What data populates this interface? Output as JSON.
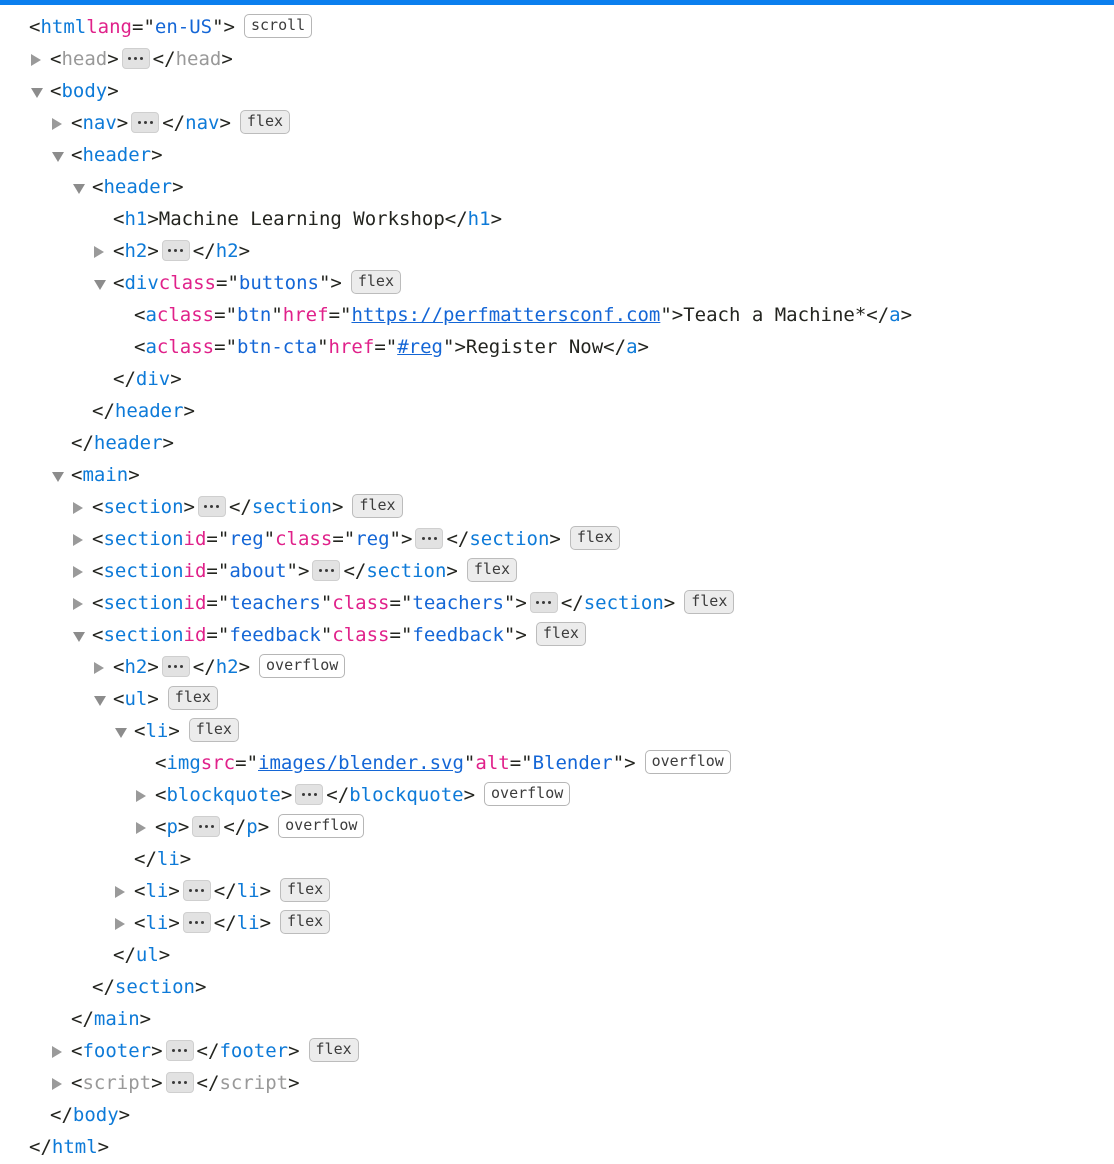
{
  "app": {
    "name": "dom-tree-inspector",
    "accent_color": "#0b7fee",
    "tag_color": "#0d7ad8",
    "attribute_color": "#e0218a",
    "value_color": "#1466d6",
    "text_color": "#23241f",
    "dim_color": "#999999"
  },
  "badges": {
    "scroll": "scroll",
    "flex": "flex",
    "overflow": "overflow"
  },
  "syntax": {
    "lt": "<",
    "gt": ">",
    "close_lt": "</",
    "eq": "=",
    "quote": "\""
  },
  "tree": {
    "lines": [
      {
        "depth": 0,
        "marker": "none",
        "tag": "html",
        "attrs": [
          {
            "name": "lang",
            "value": "en-US"
          }
        ],
        "badge": "scroll"
      },
      {
        "depth": 1,
        "marker": "closed",
        "tag": "head",
        "collapsed": true,
        "dim": true
      },
      {
        "depth": 1,
        "marker": "open",
        "tag": "body"
      },
      {
        "depth": 2,
        "marker": "closed",
        "tag": "nav",
        "collapsed": true,
        "badge": "flex"
      },
      {
        "depth": 2,
        "marker": "open",
        "tag": "header"
      },
      {
        "depth": 3,
        "marker": "open",
        "tag": "header"
      },
      {
        "depth": 4,
        "marker": "none",
        "tag": "h1",
        "inline_text": "Machine Learning Workshop"
      },
      {
        "depth": 4,
        "marker": "closed",
        "tag": "h2",
        "collapsed": true
      },
      {
        "depth": 4,
        "marker": "open",
        "tag": "div",
        "attrs": [
          {
            "name": "class",
            "value": "buttons"
          }
        ],
        "badge": "flex"
      },
      {
        "depth": 5,
        "marker": "none",
        "tag": "a",
        "attrs": [
          {
            "name": "class",
            "value": "btn"
          },
          {
            "name": "href",
            "value": "https://perfmattersconf.com",
            "link": true
          }
        ],
        "inline_text": "Teach a Machine*"
      },
      {
        "depth": 5,
        "marker": "none",
        "tag": "a",
        "attrs": [
          {
            "name": "class",
            "value": "btn-cta"
          },
          {
            "name": "href",
            "value": "#reg",
            "link": true
          }
        ],
        "inline_text": "Register Now"
      },
      {
        "depth": 4,
        "marker": "none",
        "closing": true,
        "tag": "div"
      },
      {
        "depth": 3,
        "marker": "none",
        "closing": true,
        "tag": "header"
      },
      {
        "depth": 2,
        "marker": "none",
        "closing": true,
        "tag": "header"
      },
      {
        "depth": 2,
        "marker": "open",
        "tag": "main"
      },
      {
        "depth": 3,
        "marker": "closed",
        "tag": "section",
        "collapsed": true,
        "badge": "flex"
      },
      {
        "depth": 3,
        "marker": "closed",
        "tag": "section",
        "attrs": [
          {
            "name": "id",
            "value": "reg"
          },
          {
            "name": "class",
            "value": "reg"
          }
        ],
        "collapsed": true,
        "badge": "flex"
      },
      {
        "depth": 3,
        "marker": "closed",
        "tag": "section",
        "attrs": [
          {
            "name": "id",
            "value": "about"
          }
        ],
        "collapsed": true,
        "badge": "flex"
      },
      {
        "depth": 3,
        "marker": "closed",
        "tag": "section",
        "attrs": [
          {
            "name": "id",
            "value": "teachers"
          },
          {
            "name": "class",
            "value": "teachers"
          }
        ],
        "collapsed": true,
        "badge": "flex"
      },
      {
        "depth": 3,
        "marker": "open",
        "tag": "section",
        "attrs": [
          {
            "name": "id",
            "value": "feedback"
          },
          {
            "name": "class",
            "value": "feedback"
          }
        ],
        "badge": "flex"
      },
      {
        "depth": 4,
        "marker": "closed",
        "tag": "h2",
        "collapsed": true,
        "badge": "overflow"
      },
      {
        "depth": 4,
        "marker": "open",
        "tag": "ul",
        "badge": "flex"
      },
      {
        "depth": 5,
        "marker": "open",
        "tag": "li",
        "badge": "flex"
      },
      {
        "depth": 6,
        "marker": "none",
        "tag": "img",
        "void": true,
        "attrs": [
          {
            "name": "src",
            "value": "images/blender.svg",
            "link": true
          },
          {
            "name": "alt",
            "value": "Blender"
          }
        ],
        "badge": "overflow"
      },
      {
        "depth": 6,
        "marker": "closed",
        "tag": "blockquote",
        "collapsed": true,
        "badge": "overflow"
      },
      {
        "depth": 6,
        "marker": "closed",
        "tag": "p",
        "collapsed": true,
        "badge": "overflow"
      },
      {
        "depth": 5,
        "marker": "none",
        "closing": true,
        "tag": "li"
      },
      {
        "depth": 5,
        "marker": "closed",
        "tag": "li",
        "collapsed": true,
        "badge": "flex"
      },
      {
        "depth": 5,
        "marker": "closed",
        "tag": "li",
        "collapsed": true,
        "badge": "flex"
      },
      {
        "depth": 4,
        "marker": "none",
        "closing": true,
        "tag": "ul"
      },
      {
        "depth": 3,
        "marker": "none",
        "closing": true,
        "tag": "section"
      },
      {
        "depth": 2,
        "marker": "none",
        "closing": true,
        "tag": "main"
      },
      {
        "depth": 2,
        "marker": "closed",
        "tag": "footer",
        "collapsed": true,
        "badge": "flex"
      },
      {
        "depth": 2,
        "marker": "closed",
        "tag": "script",
        "collapsed": true,
        "dim": true
      },
      {
        "depth": 1,
        "marker": "none",
        "closing": true,
        "tag": "body"
      },
      {
        "depth": 0,
        "marker": "none",
        "closing": true,
        "tag": "html"
      }
    ]
  }
}
